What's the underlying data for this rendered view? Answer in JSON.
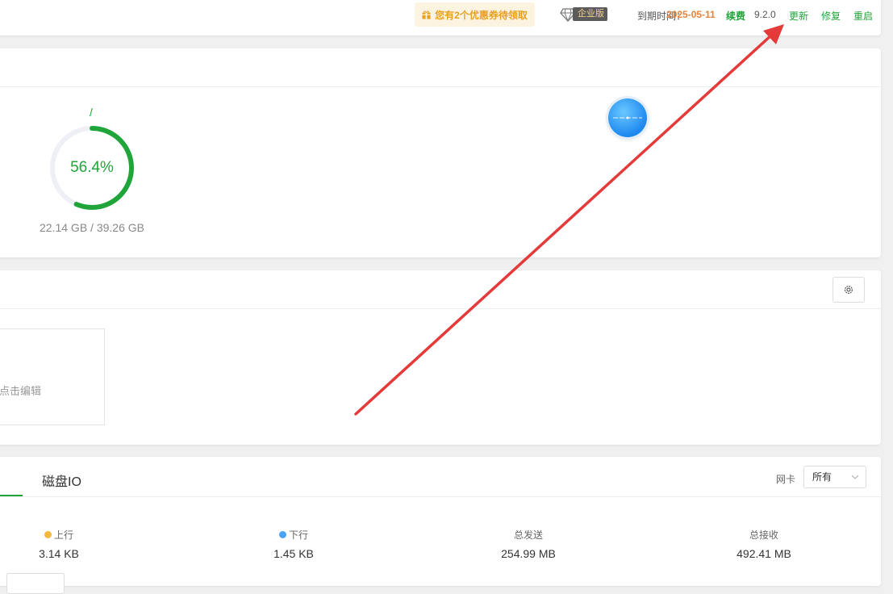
{
  "header": {
    "coupon_text": "您有2个优惠券待领取",
    "edition": "企业版",
    "expire_label": "到期时间：",
    "expire_date": "2025-05-11",
    "renew": "续费",
    "version": "9.2.0",
    "update": "更新",
    "repair": "修复",
    "restart": "重启"
  },
  "disk": {
    "path": "/",
    "percent_text": "56.4%",
    "percent_value": 56.4,
    "usage": "22.14 GB / 39.26 GB"
  },
  "software": {
    "tile_text": "点击编辑"
  },
  "traffic": {
    "tab_disk_io": "磁盘IO",
    "nic_label": "网卡",
    "nic_selected": "所有",
    "stats": [
      {
        "label": "上行",
        "value": "3.14 KB",
        "dot_color": "#f5b942"
      },
      {
        "label": "下行",
        "value": "1.45 KB",
        "dot_color": "#4ba3f5"
      },
      {
        "label": "总发送",
        "value": "254.99 MB"
      },
      {
        "label": "总接收",
        "value": "492.41 MB"
      }
    ]
  },
  "colors": {
    "accent_green": "#20a53a",
    "orange": "#e6823a",
    "annotation_arrow": "#e53a3a"
  }
}
